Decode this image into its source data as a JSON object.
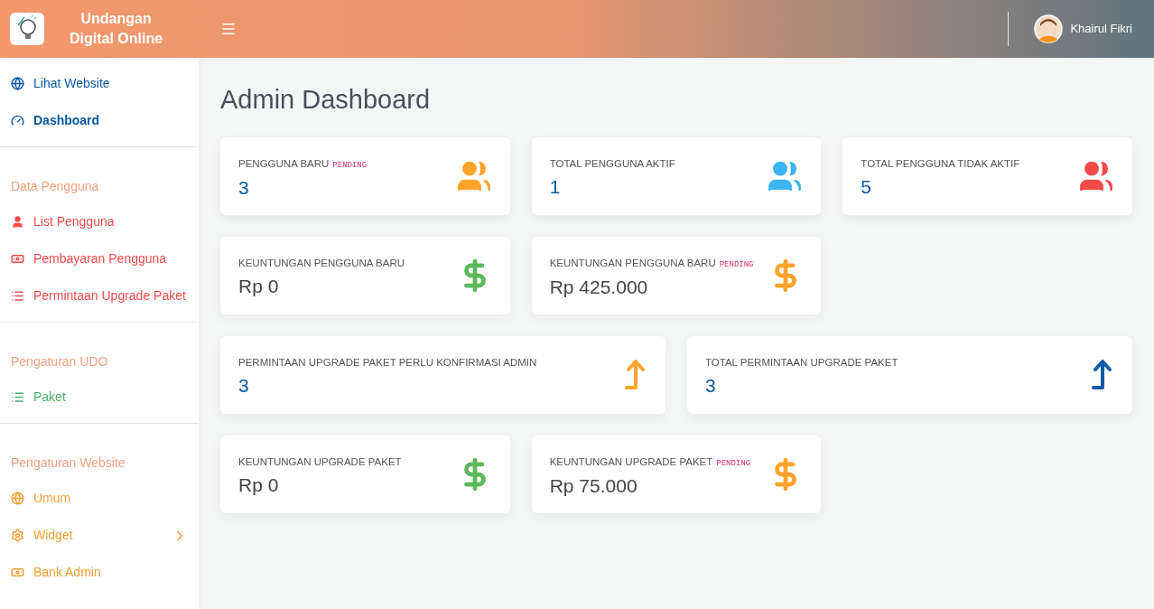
{
  "header": {
    "brand_lines": [
      "Undangan",
      "Digital Online"
    ],
    "user_name": "Khairul Fikri"
  },
  "sidebar": {
    "top_items": [
      {
        "label": "Lihat Website",
        "kind": "globe",
        "color": "#0b5aa5",
        "selected": false
      },
      {
        "label": "Dashboard",
        "kind": "gauge",
        "color": "#0b5aa5",
        "selected": true
      }
    ],
    "sections": [
      {
        "heading": "Data Pengguna",
        "items": [
          {
            "label": "List Pengguna",
            "kind": "user",
            "color": "#f44a4a",
            "selected": false,
            "expandable": false
          },
          {
            "label": "Pembayaran Pengguna",
            "kind": "money",
            "color": "#f44a4a",
            "selected": false,
            "expandable": false
          },
          {
            "label": "Permintaan Upgrade Paket",
            "kind": "list",
            "color": "#f44a4a",
            "selected": false,
            "expandable": false
          }
        ]
      },
      {
        "heading": "Pengaturan UDO",
        "items": [
          {
            "label": "Paket",
            "kind": "list",
            "color": "#4caf6a",
            "selected": false,
            "expandable": false
          }
        ]
      },
      {
        "heading": "Pengaturan Website",
        "items": [
          {
            "label": "Umum",
            "kind": "globe",
            "color": "#f7a035",
            "selected": false,
            "expandable": false
          },
          {
            "label": "Widget",
            "kind": "gear",
            "color": "#f7a035",
            "selected": false,
            "expandable": true
          },
          {
            "label": "Bank Admin",
            "kind": "money",
            "color": "#f7a035",
            "selected": false,
            "expandable": false
          }
        ]
      }
    ]
  },
  "page_title": "Admin Dashboard",
  "card_rows": [
    {
      "kind": "thirds",
      "cards": [
        {
          "title": "PENGGUNA BARU",
          "badge": "PENDING",
          "value": "3",
          "kind": "users",
          "color": "#ffa32a"
        },
        {
          "title": "TOTAL PENGGUNA AKTIF",
          "value": "1",
          "kind": "users",
          "color": "#3bb4f2"
        },
        {
          "title": "TOTAL PENGGUNA TIDAK AKTIF",
          "value": "5",
          "kind": "users",
          "color": "#f44a4a"
        }
      ]
    },
    {
      "kind": "thirds",
      "cards": [
        {
          "title": "KEUNTUNGAN PENGGUNA BARU",
          "value": "Rp 0",
          "kind": "dollar",
          "color": "#5cb85c"
        },
        {
          "title": "KEUNTUNGAN PENGGUNA BARU",
          "badge": "PENDING",
          "value": "Rp 425.000",
          "kind": "dollar",
          "color": "#ffa32a"
        }
      ]
    },
    {
      "kind": "halves",
      "cards": [
        {
          "title": "PERMINTAAN UPGRADE PAKET PERLU KONFIRMASI ADMIN",
          "value": "3",
          "kind": "upgrade",
          "color": "#ffa32a"
        },
        {
          "title": "TOTAL PERMINTAAN UPGRADE PAKET",
          "value": "3",
          "kind": "upgrade",
          "color": "#0b5aa5"
        }
      ]
    },
    {
      "kind": "thirds",
      "cards": [
        {
          "title": "KEUNTUNGAN UPGRADE PAKET",
          "value": "Rp 0",
          "kind": "dollar",
          "color": "#5cb85c"
        },
        {
          "title": "KEUNTUNGAN UPGRADE PAKET",
          "badge": "PENDING",
          "value": "Rp 75.000",
          "kind": "dollar",
          "color": "#ffa32a"
        }
      ]
    }
  ]
}
